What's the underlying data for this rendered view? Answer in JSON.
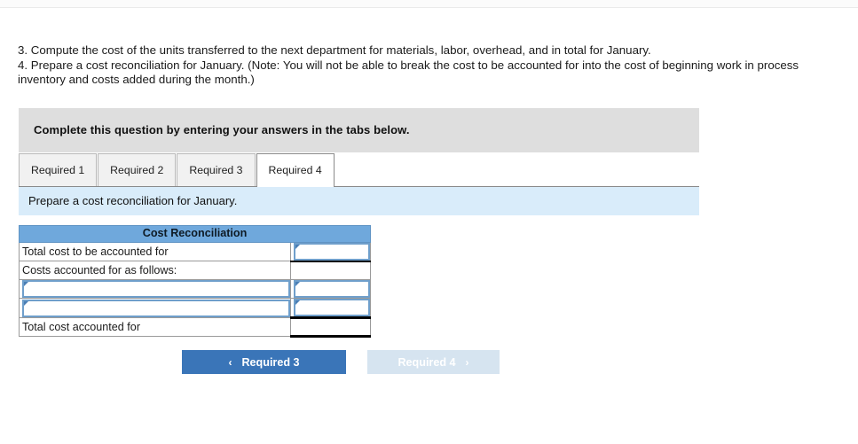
{
  "prompt": {
    "line1": "3. Compute the cost of the units transferred to the next department for materials, labor, overhead, and in total for January.",
    "line2": "4. Prepare a cost reconciliation for January. (Note: You will not be able to break the cost to be accounted for into the cost of beginning work in process inventory and costs added during the month.)"
  },
  "banner": {
    "text": "Complete this question by entering your answers in the tabs below."
  },
  "tabs": [
    {
      "label": "Required 1",
      "active": false
    },
    {
      "label": "Required 2",
      "active": false
    },
    {
      "label": "Required 3",
      "active": false
    },
    {
      "label": "Required 4",
      "active": true
    }
  ],
  "subinstruction": {
    "text": "Prepare a cost reconciliation for January."
  },
  "table": {
    "title": "Cost Reconciliation",
    "rows": [
      {
        "label": "Total cost to be accounted for",
        "value": "",
        "label_editable": false,
        "value_editable": true
      },
      {
        "label": "Costs accounted for as follows:",
        "value": "",
        "label_editable": false,
        "value_editable": false
      },
      {
        "label": "",
        "value": "",
        "label_editable": true,
        "value_editable": true
      },
      {
        "label": "",
        "value": "",
        "label_editable": true,
        "value_editable": true
      },
      {
        "label": "Total cost accounted for",
        "value": "",
        "label_editable": false,
        "value_editable": false
      }
    ]
  },
  "nav": {
    "prev_label": "Required 3",
    "next_label": "Required 4",
    "prev_icon": "chevron-left-icon",
    "next_icon": "chevron-right-icon",
    "prev_chevron": "‹",
    "next_chevron": "›"
  },
  "colors": {
    "table_header_blue": "#6fa8dc",
    "input_border_blue": "#6f9fcb",
    "banner_gray": "#dedede",
    "subinstruction_blue": "#d9ecfa",
    "button_blue": "#3a75b8",
    "button_disabled_blue": "#d6e4f0"
  }
}
